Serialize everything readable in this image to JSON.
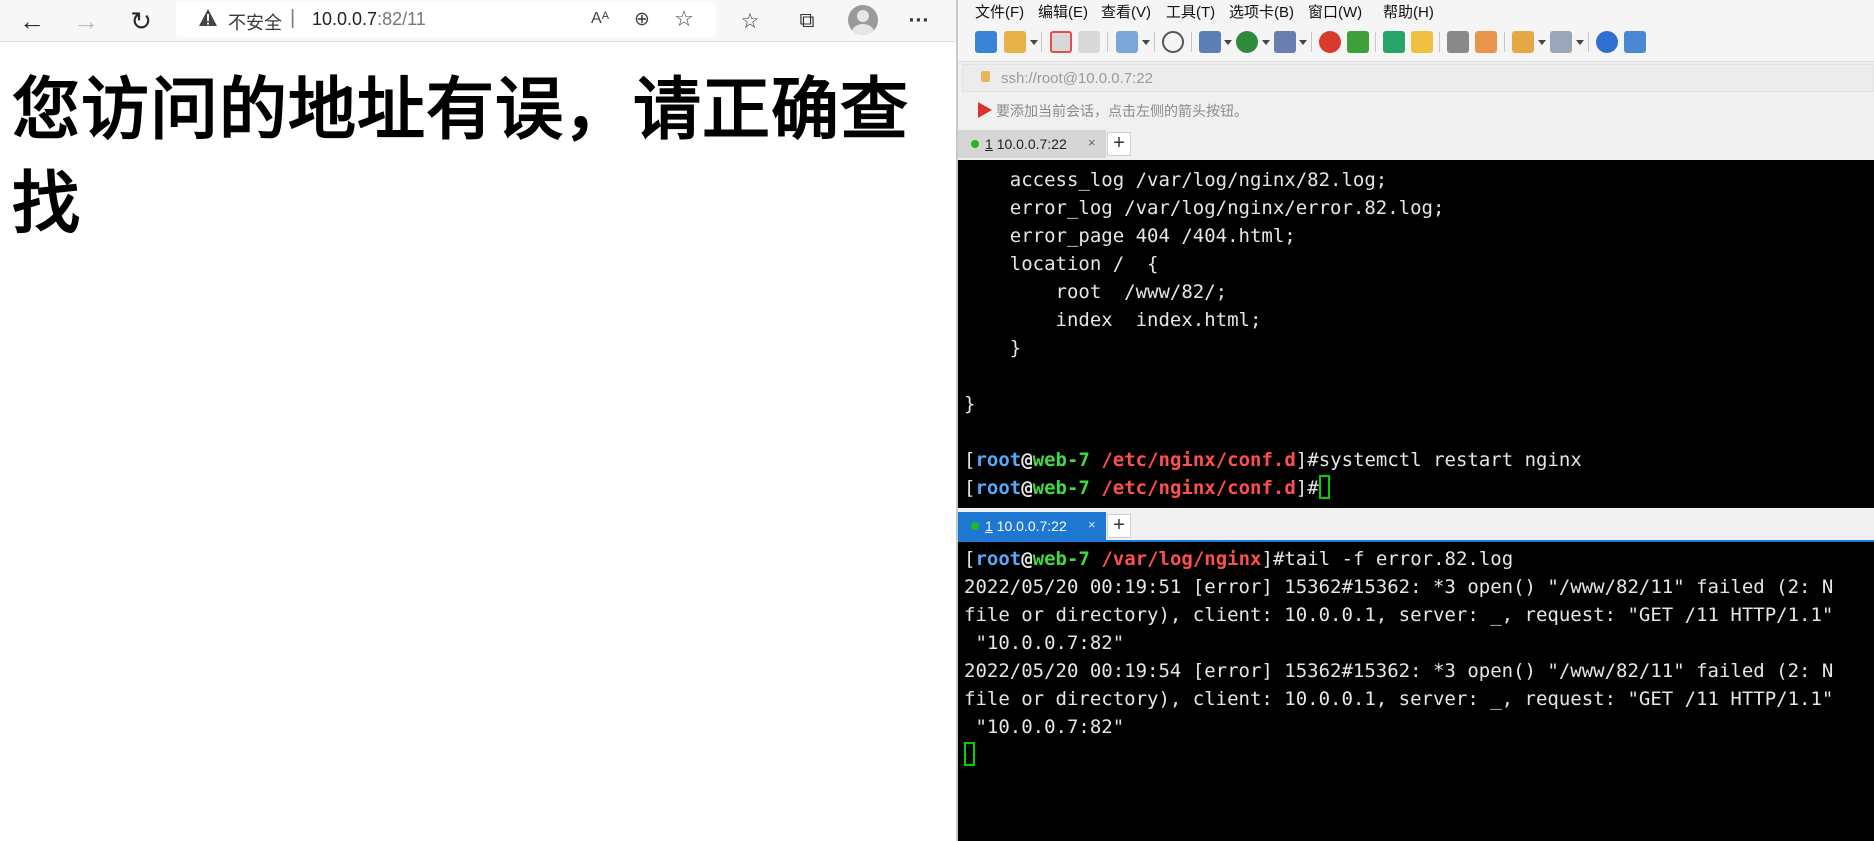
{
  "browser": {
    "security_label": "不安全",
    "separator": "|",
    "url_host": "10.0.0.7",
    "url_path": ":82/11",
    "page_heading": "您访问的地址有误，请正确查找",
    "icons": [
      "back-icon",
      "forward-icon",
      "refresh-icon",
      "warning-icon",
      "read-aloud-icon",
      "zoom-icon",
      "add-favorite-icon",
      "favorites-icon",
      "collections-icon",
      "profile-icon",
      "more-icon"
    ],
    "glyphs": {
      "back": "←",
      "forward": "→",
      "refresh": "↻",
      "read_aloud": "Aᴬ",
      "zoom": "⊕",
      "add_favorite": "☆",
      "favorites": "☆",
      "collections": "⧉",
      "more": "···"
    }
  },
  "xshell": {
    "menu": [
      "文件(F)",
      "编辑(E)",
      "查看(V)",
      "工具(T)",
      "选项卡(B)",
      "窗口(W)",
      "帮助(H)"
    ],
    "session_address": "ssh://root@10.0.0.7:22",
    "hint": "要添加当前会话，点击左侧的箭头按钮。",
    "top_tab": {
      "index": "1",
      "host": "10.0.0.7:22",
      "close": "×"
    },
    "bottom_tab": {
      "index": "1",
      "host": "10.0.0.7:22",
      "close": "×"
    },
    "tab_add": "+",
    "top_terminal": {
      "lines": [
        "    access_log /var/log/nginx/82.log;",
        "    error_log /var/log/nginx/error.82.log;",
        "    error_page 404 /404.html;",
        "    location /  {",
        "        root  /www/82/;",
        "        index  index.html;",
        "    }",
        "",
        "}",
        ""
      ],
      "prompt_user": "root",
      "prompt_at": "@",
      "prompt_host": "web-7",
      "prompt_path": "/etc/nginx/conf.d",
      "command": "#systemctl restart nginx",
      "prompt_end": "#"
    },
    "bottom_terminal": {
      "prompt_user": "root",
      "prompt_at": "@",
      "prompt_host": "web-7",
      "prompt_path": "/var/log/nginx",
      "command": "#tail -f error.82.log",
      "lines": [
        "2022/05/20 00:19:51 [error] 15362#15362: *3 open() \"/www/82/11\" failed (2: N",
        "file or directory), client: 10.0.0.1, server: _, request: \"GET /11 HTTP/1.1\"",
        " \"10.0.0.7:82\"",
        "2022/05/20 00:19:54 [error] 15362#15362: *3 open() \"/www/82/11\" failed (2: N",
        "file or directory), client: 10.0.0.1, server: _, request: \"GET /11 HTTP/1.1\"",
        " \"10.0.0.7:82\""
      ]
    },
    "colors": {
      "prompt_user": "#55aaff",
      "prompt_host": "#3fdc3f",
      "prompt_path": "#ff4e4e",
      "tab_active": "#1e78d2",
      "cursor": "#00d000"
    }
  }
}
